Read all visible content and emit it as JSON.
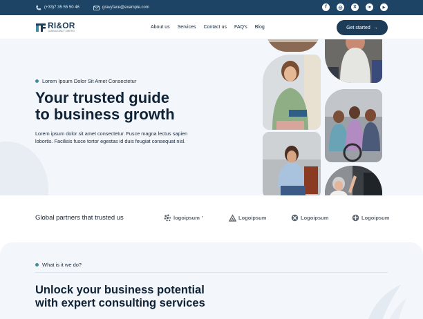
{
  "topbar": {
    "phone": "(+33)7 35 55 50 46",
    "email": "gravyface@example.com",
    "socials": [
      {
        "icon": "facebook-icon",
        "glyph": "f"
      },
      {
        "icon": "instagram-icon",
        "glyph": "◎"
      },
      {
        "icon": "x-icon",
        "glyph": "X"
      },
      {
        "icon": "linkedin-icon",
        "glyph": "in"
      },
      {
        "icon": "youtube-icon",
        "glyph": "▶"
      }
    ]
  },
  "header": {
    "logo_name": "RI&OR",
    "logo_tagline": "CONSULTANCY LIMITED",
    "nav": [
      "About us",
      "Services",
      "Contact us",
      "FAQ's",
      "Blog"
    ],
    "cta_label": "Get started",
    "cta_arrow": "→"
  },
  "hero": {
    "eyebrow": "Lorem Ipsum Dolor Sit Amet Consectetur",
    "title_line1": "Your trusted guide",
    "title_line2": "to business growth",
    "description": "Lorem ipsum dolor sit amet consectetur. Fusce magna lectus sapien lobortis. Facilisis fusce tortor egestas id duis feugiat consequat nisl."
  },
  "partners": {
    "label": "Global partners that trusted us",
    "logos": [
      "logoipsum",
      "Logoipsum",
      "Logoipsum",
      "Logoipsum"
    ],
    "logo_mark": "'"
  },
  "services": {
    "eyebrow": "What is it we do?",
    "title_line1": "Unlock your business potential",
    "title_line2": "with expert consulting services"
  },
  "colors": {
    "topbar": "#1d4464",
    "primary": "#1d3c58",
    "accent_dot": "#3d8ea0",
    "hero_bg": "#f3f6fa"
  }
}
